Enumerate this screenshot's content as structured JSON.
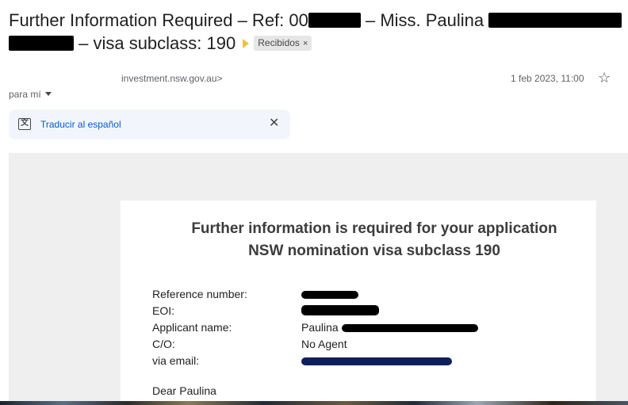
{
  "email": {
    "subject_part1": "Further Information Required – Ref: 00",
    "subject_part2": " – Miss. Paulina ",
    "subject_part3": " – visa subclass: 190",
    "label": "Recibidos",
    "label_remove": "×",
    "sender": "investment.nsw.gov.au>",
    "date": "1 feb 2023, 11:00",
    "to": "para mí",
    "translate_link": "Traducir al español",
    "translate_close": "✕",
    "star": "☆",
    "importance_color": "#f2c232"
  },
  "body": {
    "title_line1": "Further information is required for your application",
    "title_line2": "NSW nomination visa subclass 190",
    "fields": [
      {
        "label": "Reference number:",
        "value": ""
      },
      {
        "label": "EOI:",
        "value": ""
      },
      {
        "label": "Applicant name:",
        "value": "Paulina"
      },
      {
        "label": "C/O:",
        "value": "No Agent"
      },
      {
        "label": "via email:",
        "value": ""
      }
    ],
    "greeting": "Dear Paulina"
  }
}
